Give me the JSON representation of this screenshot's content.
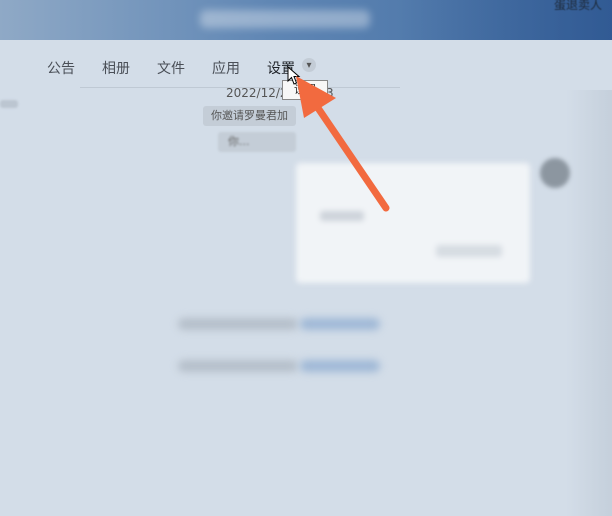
{
  "titlebar": {
    "right_text": "蛋退卖人"
  },
  "tabs": [
    {
      "label": "公告"
    },
    {
      "label": "相册"
    },
    {
      "label": "文件"
    },
    {
      "label": "应用"
    },
    {
      "label": "设置"
    }
  ],
  "chat": {
    "date_prefix": "2022/12/2",
    "date_suffix": "3",
    "notice": "你邀请罗曼君加",
    "notice2": "你..."
  },
  "tooltip": {
    "label": "设置"
  },
  "colors": {
    "arrow": "#f26a3f",
    "titlebar": "#4a74a8",
    "background": "#d3dde8"
  }
}
